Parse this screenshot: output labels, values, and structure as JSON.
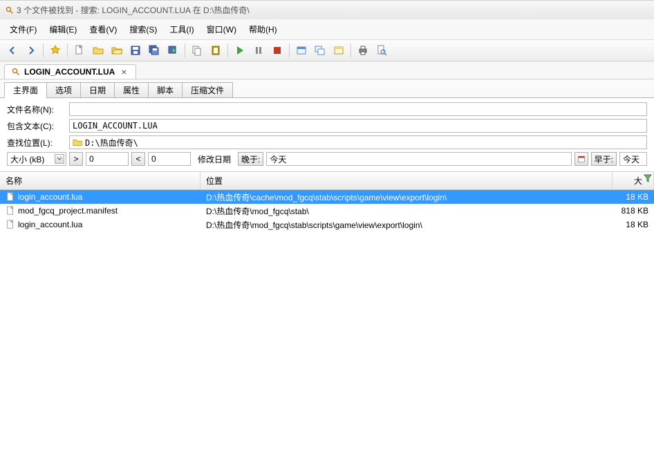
{
  "title": "3 个文件被找到 - 搜索: LOGIN_ACCOUNT.LUA 在 D:\\热血传奇\\",
  "menu": {
    "file": "文件(F)",
    "edit": "编辑(E)",
    "view": "查看(V)",
    "search": "搜索(S)",
    "tools": "工具(I)",
    "window": "窗口(W)",
    "help": "帮助(H)"
  },
  "tab": {
    "label": "LOGIN_ACCOUNT.LUA"
  },
  "subtabs": {
    "main": "主界面",
    "options": "选项",
    "date": "日期",
    "attr": "属性",
    "script": "脚本",
    "zip": "压缩文件"
  },
  "form": {
    "filename_lbl": "文件名称(N):",
    "filename_val": "",
    "contains_lbl": "包含文本(C):",
    "contains_val": "LOGIN_ACCOUNT.LUA",
    "location_lbl": "查找位置(L):",
    "location_val": "D:\\热血传奇\\",
    "size_combo": "大小 (kB)",
    "gt": ">",
    "lt": "<",
    "n0a": "0",
    "n0b": "0",
    "moddate_lbl": "修改日期",
    "after_lbl": "晚于:",
    "after_val": "今天",
    "before_lbl": "早于:",
    "before_val": "今天"
  },
  "cols": {
    "name": "名称",
    "loc": "位置",
    "size": "大"
  },
  "rows": [
    {
      "name": "login_account.lua",
      "loc": "D:\\热血传奇\\cache\\mod_fgcq\\stab\\scripts\\game\\view\\export\\login\\",
      "size": "18 KB",
      "sel": true
    },
    {
      "name": "mod_fgcq_project.manifest",
      "loc": "D:\\热血传奇\\mod_fgcq\\stab\\",
      "size": "818 KB",
      "sel": false
    },
    {
      "name": "login_account.lua",
      "loc": "D:\\热血传奇\\mod_fgcq\\stab\\scripts\\game\\view\\export\\login\\",
      "size": "18 KB",
      "sel": false
    }
  ]
}
